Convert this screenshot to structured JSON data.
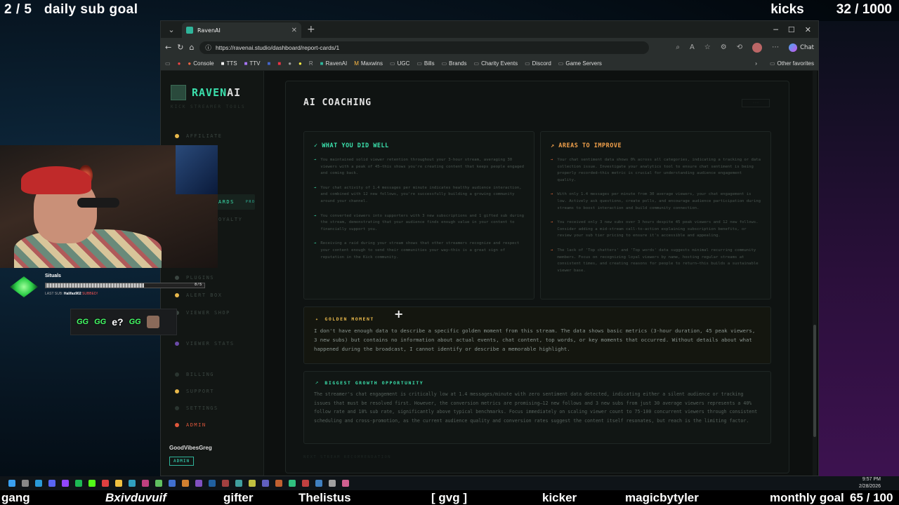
{
  "overlay": {
    "sub_goal_count": "2 / 5",
    "sub_goal_label": "daily sub goal",
    "kicks_label": "kicks",
    "kicks_count": "32 / 1000",
    "ticker": [
      "gang",
      "Bxivduvuif",
      "gifter",
      "Thelistus",
      "[ gvg ]",
      "kicker",
      "magicbytyler",
      "monthly goal",
      "65 / 100"
    ],
    "sub_name": "Situals",
    "sub_progress_text": "8 / 5",
    "last_sub_prefix": "LAST SUB:",
    "last_sub_name": "Halifax902",
    "last_sub_suffix": "SUBBED!",
    "emotes": [
      "GG",
      "GG",
      "e?",
      "GG"
    ]
  },
  "browser": {
    "tab_title": "RavenAI",
    "url": "https://ravenai.studio/dashboard/report-cards/1",
    "chat_label": "Chat",
    "bookmarks": [
      "Console",
      "TTS",
      "TTV",
      "RavenAI",
      "Maxwins",
      "UGC",
      "Bills",
      "Brands",
      "Charity Events",
      "Discord",
      "Game Servers"
    ],
    "other_favorites": "Other favorites"
  },
  "app": {
    "logo_prefix": "RAVEN",
    "logo_suffix": "AI",
    "tagline": "KICK STREAMER TOOLS",
    "nav": {
      "affiliate": "AFFILIATE",
      "report_cards": "ARDS",
      "pro": "PRO",
      "loyalty": "OYALTY",
      "plugins": "PLUGINS",
      "alert_box": "ALERT BOX",
      "viewer_shop": "VIEWER SHOP",
      "viewer_stats": "VIEWER STATS",
      "billing": "BILLING",
      "support": "SUPPORT",
      "settings": "SETTINGS",
      "admin": "ADMIN"
    },
    "user_name": "GoodVibesGreg",
    "user_role": "ADMIN"
  },
  "coaching": {
    "title": "AI COACHING",
    "good_title": "✓ WHAT YOU DID WELL",
    "good": [
      "You maintained solid viewer retention throughout your 3-hour stream, averaging 30 viewers with a peak of 45—this shows you're creating content that keeps people engaged and coming back.",
      "Your chat activity of 1.4 messages per minute indicates healthy audience interaction, and combined with 12 new follows, you're successfully building a growing community around your channel.",
      "You converted viewers into supporters with 3 new subscriptions and 1 gifted sub during the stream, demonstrating that your audience finds enough value in your content to financially support you.",
      "Receiving a raid during your stream shows that other streamers recognize and respect your content enough to send their communities your way—this is a great sign of reputation in the Kick community."
    ],
    "improve_title": "↗ AREAS TO IMPROVE",
    "improve": [
      "Your chat sentiment data shows 0% across all categories, indicating a tracking or data collection issue. Investigate your analytics tool to ensure chat sentiment is being properly recorded—this metric is crucial for understanding audience engagement quality.",
      "With only 1.4 messages per minute from 30 average viewers, your chat engagement is low. Actively ask questions, create polls, and encourage audience participation during streams to boost interaction and build community connection.",
      "You received only 3 new subs over 3 hours despite 45 peak viewers and 12 new follows. Consider adding a mid-stream call-to-action explaining subscription benefits, or review your sub tier pricing to ensure it's accessible and appealing.",
      "The lack of 'Top chatters' and 'Top words' data suggests minimal recurring community members. Focus on recognizing loyal viewers by name, hosting regular streams at consistent times, and creating reasons for people to return—this builds a sustainable viewer base."
    ],
    "golden_title": "GOLDEN MOMENT",
    "golden_text": "I don't have enough data to describe a specific golden moment from this stream. The data shows basic metrics (3-hour duration, 45 peak viewers, 3 new subs) but contains no information about actual events, chat content, top words, or key moments that occurred. Without details about what happened during the broadcast, I cannot identify or describe a memorable highlight.",
    "growth_title": "BIGGEST GROWTH OPPORTUNITY",
    "growth_text": "The streamer's chat engagement is critically low at 1.4 messages/minute with zero sentiment data detected, indicating either a silent audience or tracking issues that must be resolved first. However, the conversion metrics are promising—12 new follows and 3 new subs from just 30 average viewers represents a 40% follow rate and 10% sub rate, significantly above typical benchmarks. Focus immediately on scaling viewer count to 75-100 concurrent viewers through consistent scheduling and cross-promotion, as the current audience quality and conversion rates suggest the content itself resonates, but reach is the limiting factor.",
    "next_section": "NEXT STREAM RECOMMENDATION"
  },
  "taskbar": {
    "time": "9:57 PM",
    "date": "2/28/2026"
  },
  "colors": {
    "accent": "#3be0ac",
    "warning": "#f0a04b",
    "gold": "#e8b84b"
  }
}
